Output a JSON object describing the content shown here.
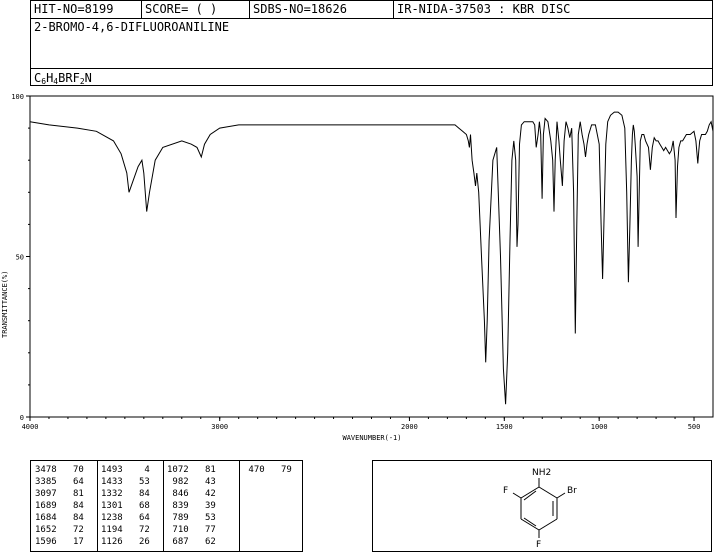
{
  "header": {
    "hit_no": "HIT-NO=8199",
    "score": "SCORE=  (   )",
    "sdbs_no": "SDBS-NO=18626",
    "ir_info": "IR-NIDA-37503 : KBR DISC",
    "compound_name": "2-BROMO-4,6-DIFLUOROANILINE",
    "formula": {
      "c": "C",
      "c_n": "6",
      "h": "H",
      "h_n": "4",
      "br": "BR",
      "f": "F",
      "f_n": "2",
      "n": "N"
    }
  },
  "chart_data": {
    "type": "line",
    "xlabel": "WAVENUMBER(-1)",
    "ylabel": "TRANSMITTANCE(%)",
    "xlim": [
      4000,
      400
    ],
    "ylim": [
      0,
      100
    ],
    "x_ticks": [
      4000,
      3000,
      2000,
      1500,
      1000,
      500
    ],
    "y_ticks": [
      0,
      50,
      100
    ],
    "grid": false,
    "series": [
      {
        "x": [
          4000,
          3900,
          3750,
          3650,
          3560,
          3520,
          3490,
          3478,
          3460,
          3430,
          3410,
          3400,
          3385,
          3370,
          3340,
          3300,
          3200,
          3150,
          3120,
          3097,
          3080,
          3050,
          3000,
          2900,
          2700,
          2500,
          2300,
          2100,
          2000,
          1900,
          1850,
          1800,
          1780,
          1760,
          1740,
          1720,
          1700,
          1690,
          1684,
          1678,
          1670,
          1660,
          1652,
          1645,
          1635,
          1620,
          1605,
          1598,
          1590,
          1580,
          1560,
          1540,
          1520,
          1505,
          1493,
          1482,
          1470,
          1460,
          1450,
          1440,
          1433,
          1428,
          1420,
          1410,
          1395,
          1380,
          1365,
          1350,
          1340,
          1332,
          1322,
          1315,
          1308,
          1301,
          1294,
          1285,
          1270,
          1255,
          1245,
          1238,
          1232,
          1222,
          1212,
          1205,
          1194,
          1185,
          1175,
          1165,
          1155,
          1145,
          1135,
          1126,
          1118,
          1110,
          1100,
          1090,
          1080,
          1072,
          1064,
          1055,
          1040,
          1020,
          1000,
          990,
          982,
          975,
          965,
          955,
          940,
          920,
          900,
          880,
          865,
          855,
          846,
          838,
          830,
          825,
          820,
          815,
          810,
          800,
          795,
          789,
          783,
          775,
          765,
          755,
          740,
          730,
          720,
          710,
          700,
          690,
          680,
          670,
          660,
          650,
          640,
          630,
          620,
          610,
          600,
          595,
          587,
          580,
          570,
          560,
          540,
          520,
          500,
          490,
          480,
          475,
          470,
          460,
          450,
          440,
          430,
          420,
          410,
          400
        ],
        "y": [
          92,
          91,
          90,
          89,
          86,
          82,
          76,
          70,
          73,
          78,
          80,
          76,
          64,
          70,
          80,
          84,
          86,
          85,
          84,
          81,
          85,
          88,
          90,
          91,
          91,
          91,
          91,
          91,
          91,
          91,
          91,
          91,
          91,
          91,
          90,
          89,
          88,
          86,
          84,
          88,
          80,
          76,
          72,
          76,
          70,
          50,
          30,
          17,
          30,
          55,
          80,
          84,
          50,
          15,
          4,
          20,
          55,
          80,
          86,
          80,
          53,
          60,
          85,
          91,
          92,
          92,
          92,
          92,
          91,
          84,
          88,
          92,
          88,
          68,
          88,
          93,
          92,
          86,
          80,
          64,
          80,
          92,
          86,
          80,
          72,
          86,
          92,
          90,
          87,
          90,
          70,
          26,
          60,
          88,
          92,
          88,
          85,
          81,
          85,
          88,
          91,
          91,
          85,
          60,
          43,
          60,
          85,
          92,
          94,
          95,
          95,
          94,
          90,
          70,
          42,
          60,
          80,
          88,
          91,
          89,
          85,
          75,
          53,
          70,
          86,
          88,
          88,
          86,
          84,
          77,
          84,
          87,
          86,
          86,
          85,
          84,
          83,
          84,
          83,
          82,
          83,
          86,
          80,
          62,
          78,
          84,
          86,
          86,
          88,
          88,
          89,
          86,
          79,
          83,
          86,
          88,
          88,
          88,
          89,
          91,
          92,
          89
        ]
      }
    ]
  },
  "peak_table": {
    "columns": [
      [
        [
          "3478",
          "70"
        ],
        [
          "3385",
          "64"
        ],
        [
          "3097",
          "81"
        ],
        [
          "1689",
          "84"
        ],
        [
          "1684",
          "84"
        ],
        [
          "1652",
          "72"
        ],
        [
          "1596",
          "17"
        ]
      ],
      [
        [
          "1493",
          "4"
        ],
        [
          "1433",
          "53"
        ],
        [
          "1332",
          "84"
        ],
        [
          "1301",
          "68"
        ],
        [
          "1238",
          "64"
        ],
        [
          "1194",
          "72"
        ],
        [
          "1126",
          "26"
        ]
      ],
      [
        [
          "1072",
          "81"
        ],
        [
          "982",
          "43"
        ],
        [
          "846",
          "42"
        ],
        [
          "839",
          "39"
        ],
        [
          "789",
          "53"
        ],
        [
          "710",
          "77"
        ],
        [
          "687",
          "62"
        ]
      ],
      [
        [
          "470",
          "79"
        ]
      ]
    ]
  },
  "structure": {
    "labels": {
      "nh2": "NH2",
      "br": "Br",
      "f_left": "F",
      "f_bottom": "F"
    }
  }
}
